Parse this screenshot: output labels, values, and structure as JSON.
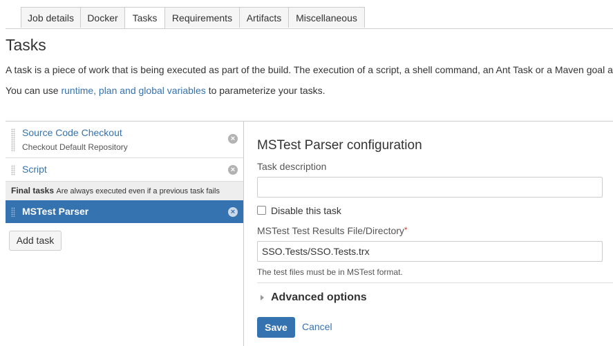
{
  "tabs": [
    {
      "label": "Job details",
      "active": false
    },
    {
      "label": "Docker",
      "active": false
    },
    {
      "label": "Tasks",
      "active": true
    },
    {
      "label": "Requirements",
      "active": false
    },
    {
      "label": "Artifacts",
      "active": false
    },
    {
      "label": "Miscellaneous",
      "active": false
    }
  ],
  "page": {
    "title": "Tasks",
    "description": "A task is a piece of work that is being executed as part of the build. The execution of a script, a shell command, an Ant Task or a Maven goal a",
    "variables_prefix": "You can use ",
    "variables_link": "runtime, plan and global variables",
    "variables_suffix": " to parameterize your tasks."
  },
  "task_list": {
    "tasks": [
      {
        "title": "Source Code Checkout",
        "subtitle": "Checkout Default Repository"
      },
      {
        "title": "Script",
        "subtitle": ""
      }
    ],
    "final_header": {
      "title": "Final tasks",
      "subtitle": "Are always executed even if a previous task fails"
    },
    "final_tasks": [
      {
        "title": "MSTest Parser",
        "selected": true
      }
    ],
    "remove_icon": "remove-icon",
    "add_task_label": "Add task"
  },
  "config": {
    "title": "MSTest Parser configuration",
    "task_description_label": "Task description",
    "task_description_value": "",
    "disable_label": "Disable this task",
    "disable_checked": false,
    "results_label": "MSTest Test Results File/Directory",
    "required_mark": "*",
    "results_value": "SSO.Tests/SSO.Tests.trx",
    "help_text": "The test files must be in MSTest format.",
    "advanced_label": "Advanced options",
    "save_label": "Save",
    "cancel_label": "Cancel"
  },
  "colors": {
    "accent": "#3572b0",
    "required": "#d04437",
    "border": "#cccccc"
  }
}
